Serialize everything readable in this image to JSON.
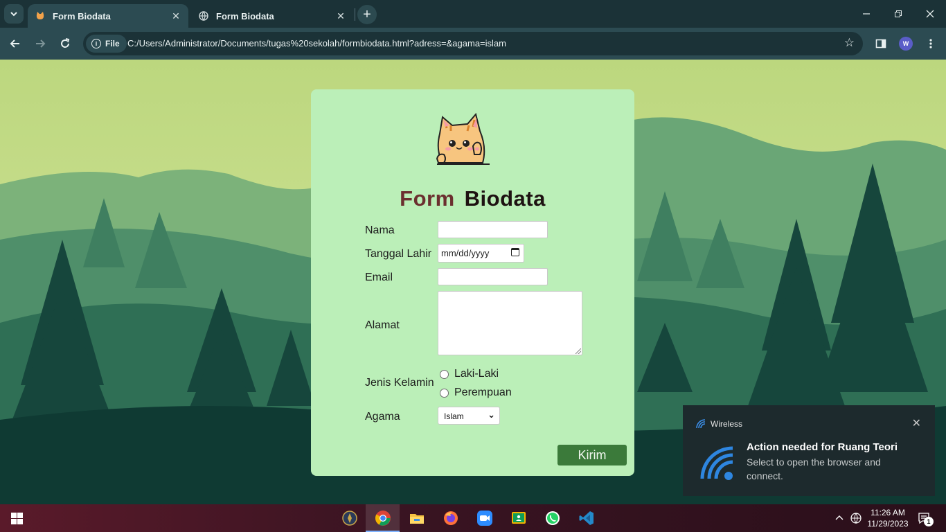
{
  "browser": {
    "tabs": [
      {
        "title": "Form Biodata",
        "active": true,
        "favicon": "cat-favicon"
      },
      {
        "title": "Form Biodata",
        "active": false,
        "favicon": "globe-icon"
      }
    ],
    "site_chip": "File",
    "url": "C:/Users/Administrator/Documents/tugas%20sekolah/formbiodata.html?adress=&agama=islam",
    "profile_initial": "W"
  },
  "form": {
    "title_part1": "Form",
    "title_part2": "Biodata",
    "labels": {
      "nama": "Nama",
      "tanggal_lahir": "Tanggal Lahir",
      "email": "Email",
      "alamat": "Alamat",
      "jenis_kelamin": "Jenis Kelamin",
      "agama": "Agama"
    },
    "date_placeholder": "mm/dd/yyyy",
    "gender_options": [
      "Laki-Laki",
      "Perempuan"
    ],
    "agama_selected": "Islam",
    "submit_label": "Kirim"
  },
  "toast": {
    "app_name": "Wireless",
    "title": "Action needed for Ruang Teori",
    "body": "Select to open the browser and connect."
  },
  "taskbar": {
    "time": "11:26 AM",
    "date": "11/29/2023",
    "notification_count": "1"
  },
  "colors": {
    "card_bg": "#bbefb8",
    "title_form": "#6b2f2f",
    "title_biodata": "#1e1212",
    "submit_bg": "#3b7a3a",
    "browser_frame": "#1b3237"
  }
}
